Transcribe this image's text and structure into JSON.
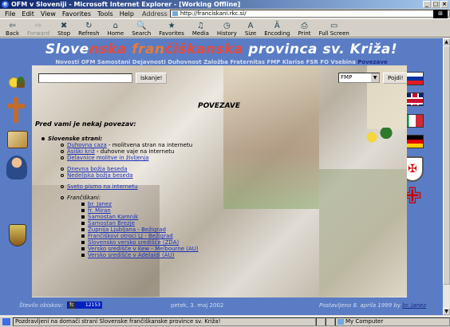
{
  "window": {
    "title": "OFM v Sloveniji - Microsoft Internet Explorer - [Working Offline]",
    "buttons": [
      "_",
      "□",
      "×"
    ]
  },
  "menu": [
    "File",
    "Edit",
    "View",
    "Favorites",
    "Tools",
    "Help"
  ],
  "address": {
    "label": "Address",
    "url": "http://franciskani.rkc.si/"
  },
  "toolbar": [
    {
      "label": "Back",
      "icon": "back-icon",
      "glyph": "⇦",
      "enabled": true
    },
    {
      "label": "Forward",
      "icon": "forward-icon",
      "glyph": "⇨",
      "enabled": false
    },
    {
      "label": "Stop",
      "icon": "stop-icon",
      "glyph": "✖",
      "enabled": true
    },
    {
      "label": "Refresh",
      "icon": "refresh-icon",
      "glyph": "↻",
      "enabled": true
    },
    {
      "label": "Home",
      "icon": "home-icon",
      "glyph": "⌂",
      "enabled": true
    },
    {
      "label": "Search",
      "icon": "search-icon",
      "glyph": "🔍",
      "enabled": true
    },
    {
      "label": "Favorites",
      "icon": "favorites-icon",
      "glyph": "★",
      "enabled": true
    },
    {
      "label": "Media",
      "icon": "media-icon",
      "glyph": "♫",
      "enabled": true
    },
    {
      "label": "History",
      "icon": "history-icon",
      "glyph": "◷",
      "enabled": true
    },
    {
      "label": "Size",
      "icon": "size-icon",
      "glyph": "A",
      "enabled": true
    },
    {
      "label": "Encoding",
      "icon": "encoding-icon",
      "glyph": "Ä",
      "enabled": true
    },
    {
      "label": "Print",
      "icon": "print-icon",
      "glyph": "⎙",
      "enabled": true
    },
    {
      "label": "Full Screen",
      "icon": "fullscreen-icon",
      "glyph": "▭",
      "enabled": true
    }
  ],
  "site": {
    "title_parts": [
      "Slove",
      "nska ",
      "fran",
      "čiškanska",
      " provinca sv. Križa!"
    ],
    "nav": [
      "Novosti",
      "OFM",
      "Samostani",
      "Dejavnosti",
      "Duhovnost",
      "Založba",
      "Fraternitas",
      "FMP",
      "Klarise",
      "FSR",
      "FO",
      "Vsebina"
    ],
    "nav_current": "Povezave"
  },
  "search": {
    "button": "Iskanje!",
    "value": ""
  },
  "selector": {
    "selected": "FMP",
    "button": "Pojdi!"
  },
  "content": {
    "heading": "POVEZAVE",
    "intro": "Pred vami je nekaj povezav:",
    "section1": "Slovenske strani:",
    "links1": [
      {
        "link": "Duhovna caza",
        "desc": " - molitvena stran na internetu"
      },
      {
        "link": "Asiški križ",
        "desc": " - duhovne vaje na internetu"
      },
      {
        "link": "Delavnice molitve in življenja",
        "desc": ""
      }
    ],
    "links2": [
      "Dnevna božja beseda",
      "Nedeljska božja beseda"
    ],
    "links3": [
      "Sveto pismo na internetu"
    ],
    "section2": "Frančiškani:",
    "franciscans": [
      "br. Janez",
      "fr. Miran",
      "Samostan Kamnik",
      "Samostan Brezje",
      "Župnija Ljubljana - Bežigrad",
      "Frančiškovi otroci LJ - Bežigrad",
      "Slovensko versko središče (ZDA)",
      "Versko središče v Kew - Melbourne (AU)",
      "Versko središče v Adelaidi (AU)"
    ]
  },
  "footer": {
    "visits_label": "Število obiskov:",
    "counter_prefix": "fc",
    "counter": "12153",
    "date": "petek, 3. maj 2002",
    "posted": "Postavljeno 8. aprila 1999 by",
    "author": "br. Janez"
  },
  "status": {
    "text": "Pozdravljeni na domači strani Slovenske frančiškanske province sv. Križa!",
    "zone": "My Computer"
  }
}
